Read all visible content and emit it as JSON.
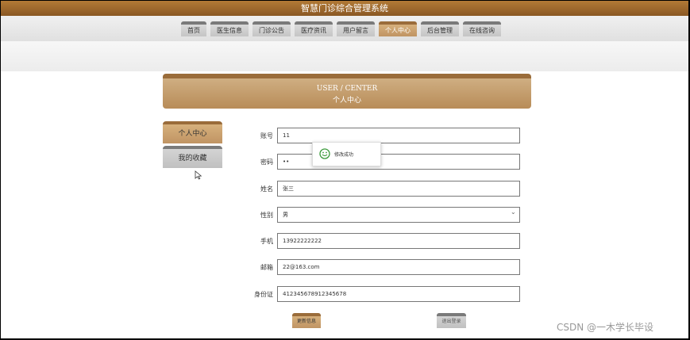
{
  "app": {
    "title": "智慧门诊综合管理系统"
  },
  "nav": {
    "items": [
      "首页",
      "医生信息",
      "门诊公告",
      "医疗资讯",
      "用户留言",
      "个人中心",
      "后台管理",
      "在线咨询"
    ],
    "active": "个人中心"
  },
  "header": {
    "en": "USER / CENTER",
    "cn": "个人中心"
  },
  "sidebar": {
    "items": [
      "个人中心",
      "我的收藏"
    ]
  },
  "form": {
    "account": {
      "label": "账号",
      "value": "11"
    },
    "password": {
      "label": "密码",
      "value": "••"
    },
    "name": {
      "label": "姓名",
      "value": "张三"
    },
    "gender": {
      "label": "性别",
      "value": "男"
    },
    "phone": {
      "label": "手机",
      "value": "13922222222"
    },
    "email": {
      "label": "邮箱",
      "value": "22@163.com"
    },
    "id_card": {
      "label": "身份证",
      "value": "412345678912345678"
    }
  },
  "toast": {
    "message": "修改成功"
  },
  "buttons": {
    "update": "更新信息",
    "logout": "退出登录"
  },
  "watermark": "CSDN @一木学长毕设",
  "colors": {
    "accent": "#c09463",
    "accent_dark": "#9a6c3a",
    "title_bar": "#8a5824"
  }
}
